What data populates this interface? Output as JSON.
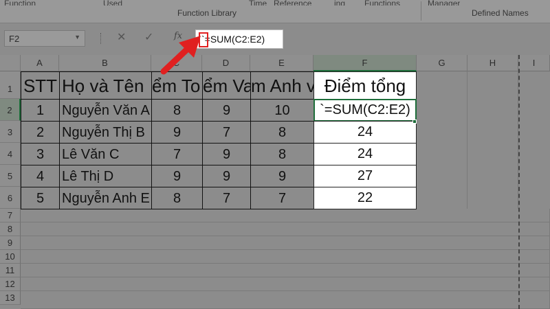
{
  "ribbon": {
    "top_fragments": [
      "Function",
      "Used",
      "Time",
      "Reference",
      "ing",
      "Functions",
      "Manager"
    ],
    "group_labels": {
      "function_library": "Function Library",
      "defined_names": "Defined Names"
    }
  },
  "formula_bar": {
    "name_box": "F2",
    "name_box_arrow": "▼",
    "cancel": "✕",
    "enter": "✓",
    "fx": "fx",
    "content_tick": "`",
    "content_formula": "=SUM(C2:E2)"
  },
  "columns": [
    "A",
    "B",
    "C",
    "D",
    "E",
    "F",
    "G",
    "H",
    "I"
  ],
  "rows": [
    "1",
    "2",
    "3",
    "4",
    "5",
    "6",
    "7",
    "8",
    "9",
    "10",
    "11",
    "12",
    "13"
  ],
  "table": {
    "headers": {
      "A": "STT",
      "B": "Họ và Tên",
      "C": "ểm To",
      "D": "ểm Va",
      "E": "m Anh v",
      "F": "Điểm tổng"
    },
    "data": [
      {
        "A": "1",
        "B": "Nguyễn Văn A",
        "C": "8",
        "D": "9",
        "E": "10",
        "F": "`=SUM(C2:E2)"
      },
      {
        "A": "2",
        "B": "Nguyễn Thị B",
        "C": "9",
        "D": "7",
        "E": "8",
        "F": "24"
      },
      {
        "A": "3",
        "B": "Lê Văn C",
        "C": "7",
        "D": "9",
        "E": "8",
        "F": "24"
      },
      {
        "A": "4",
        "B": "Lê Thị D",
        "C": "9",
        "D": "9",
        "E": "9",
        "F": "27"
      },
      {
        "A": "5",
        "B": "Nguyễn Anh E",
        "C": "8",
        "D": "7",
        "E": "7",
        "F": "22"
      }
    ]
  },
  "colors": {
    "selection": "#1e6e3a",
    "annotation": "#e02020"
  }
}
